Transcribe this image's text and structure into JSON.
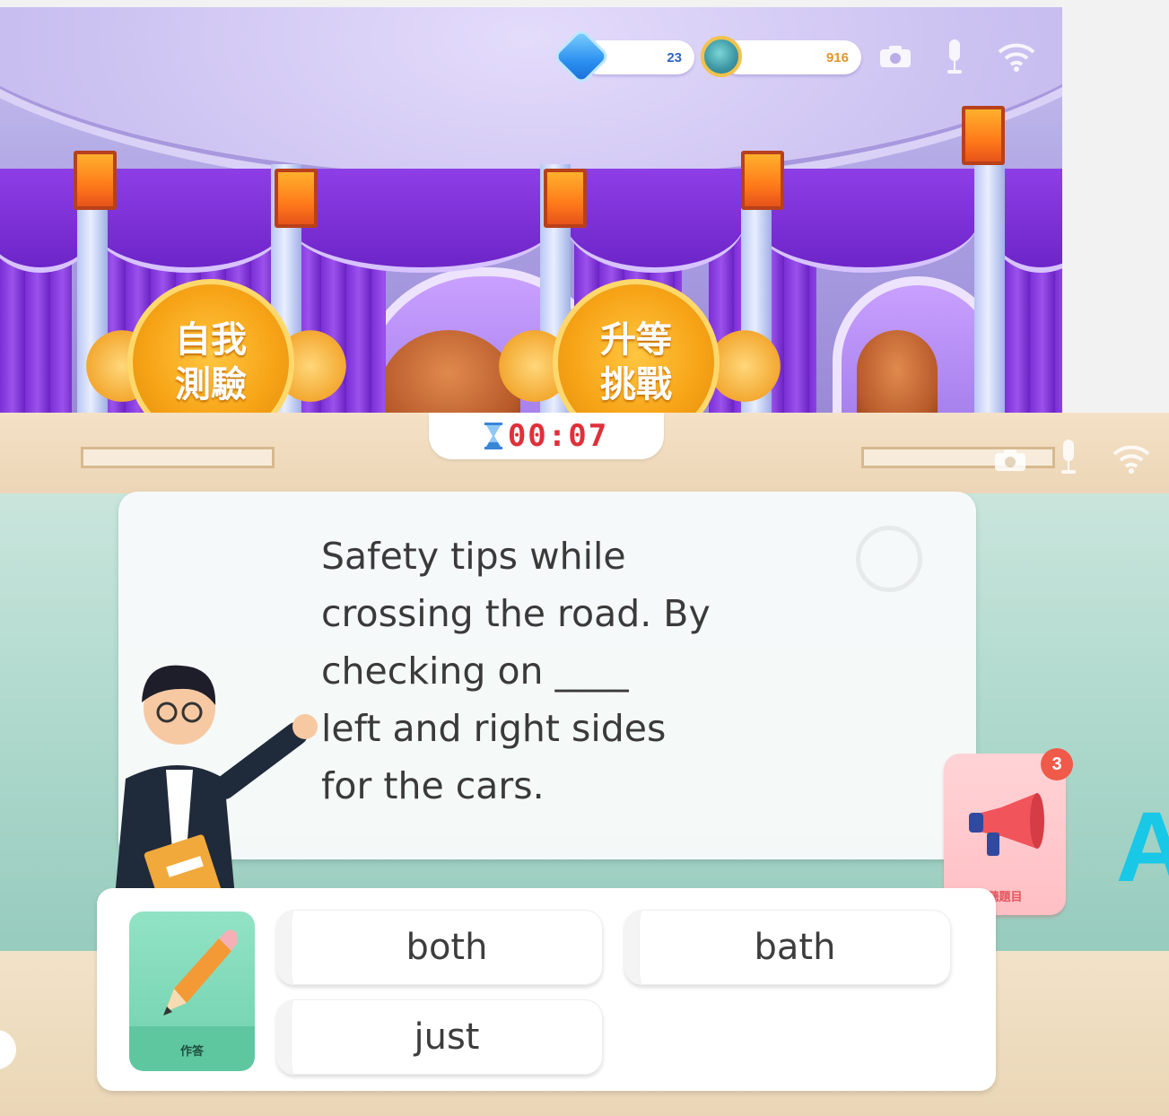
{
  "lobby": {
    "gem_count": "23",
    "trophy_points": "916",
    "medals": [
      {
        "line1": "自我",
        "line2": "測驗"
      },
      {
        "line1": "升等",
        "line2": "挑戰"
      }
    ]
  },
  "quiz": {
    "timer": "00:07",
    "question": "Safety tips while\ncrossing the road. By\nchecking on ____\nleft and right sides\nfor the cars.",
    "listen_badge": "3",
    "listen_label": "聽題目",
    "answer_label": "作答",
    "options": [
      "both",
      "bath",
      "just"
    ],
    "overlay_letter": "A"
  },
  "colors": {
    "timer": "#e0303a",
    "listen_button": "#ffc7cb",
    "answer_button": "#79d6b4",
    "overlay_letter": "#19c7e6"
  },
  "icons": [
    "gem-icon",
    "trophy-icon",
    "camera-icon",
    "microphone-icon",
    "wifi-icon",
    "hourglass-icon",
    "clock-icon",
    "megaphone-icon",
    "pencil-icon"
  ]
}
